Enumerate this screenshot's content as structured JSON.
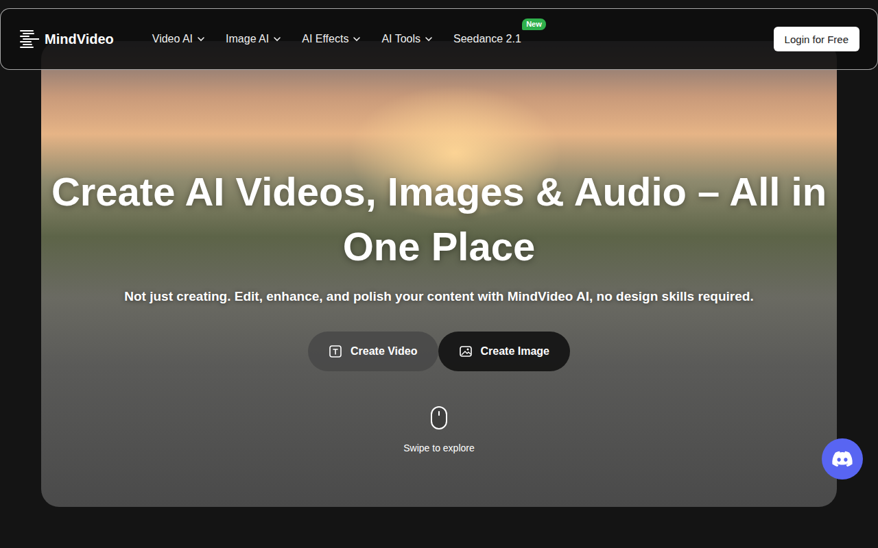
{
  "nav": {
    "logo": "MindVideo",
    "items": [
      {
        "label": "Video AI",
        "dropdown": true
      },
      {
        "label": "Image AI",
        "dropdown": true
      },
      {
        "label": "AI Effects",
        "dropdown": true
      },
      {
        "label": "AI Tools",
        "dropdown": true
      },
      {
        "label": "Seedance 2.1",
        "dropdown": false,
        "badge": "New"
      }
    ],
    "login": "Login for Free"
  },
  "hero": {
    "title": "Create AI Videos, Images & Audio – All in One Place",
    "subtitle": "Not just creating. Edit, enhance, and polish your content with MindVideo AI, no design skills required.",
    "buttons": [
      {
        "label": "Create Video",
        "kind": "light"
      },
      {
        "label": "Create Image",
        "kind": "dark"
      }
    ],
    "scroll_hint": "Swipe to explore"
  }
}
